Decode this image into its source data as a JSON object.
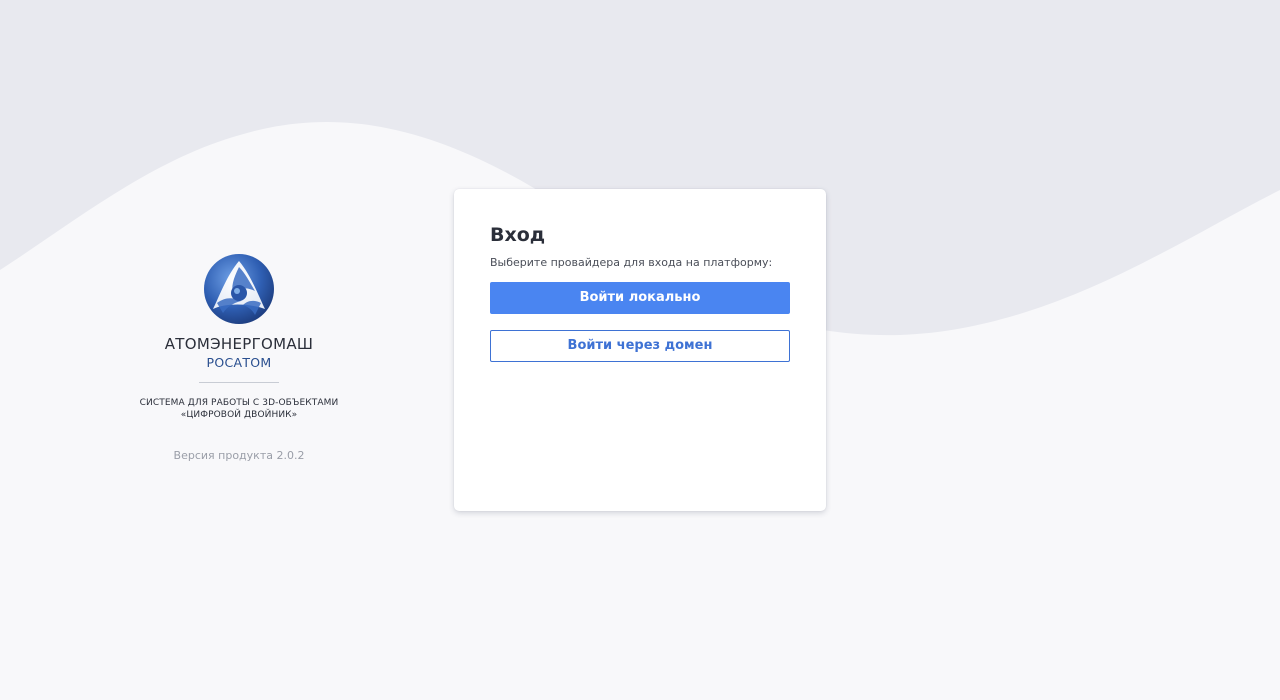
{
  "brand": {
    "company": "АТОМЭНЕРГОМАШ",
    "parent": "РОСАТОМ",
    "system_line1": "СИСТЕМА ДЛЯ РАБОТЫ С 3D-ОБЪЕКТАМИ",
    "system_line2": "«ЦИФРОВОЙ ДВОЙНИК»",
    "version": "Версия продукта 2.0.2"
  },
  "login": {
    "title": "Вход",
    "subtitle": "Выберите провайдера для входа на платформу:",
    "local_button": "Войти локально",
    "domain_button": "Войти через домен"
  },
  "colors": {
    "primary": "#4a85f1",
    "outline": "#3e72d4",
    "background": "#f8f8fa",
    "wave": "#e8e9ef"
  },
  "icons": {
    "logo": "rosatom-logo-icon"
  }
}
